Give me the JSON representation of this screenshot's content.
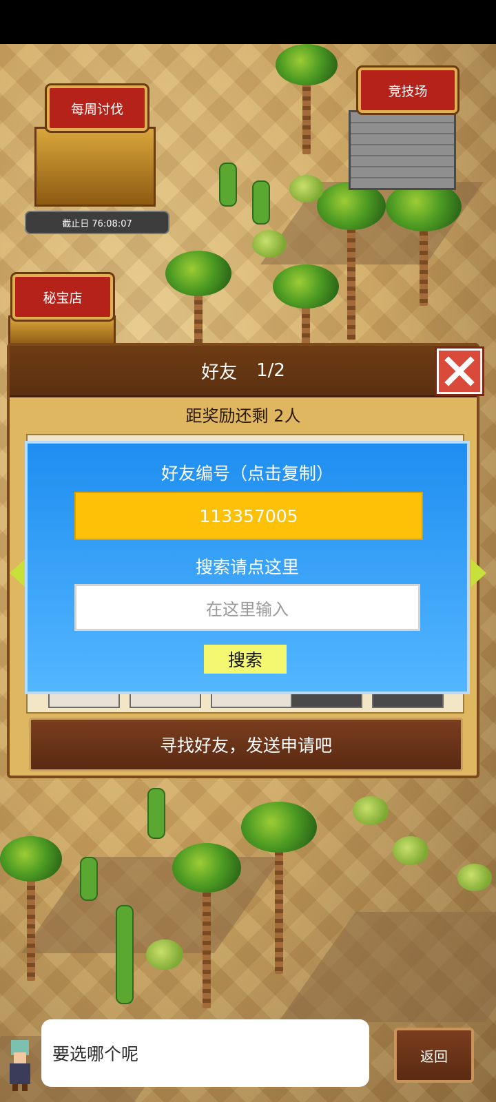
{
  "map": {
    "weekly_subjugation_label": "每周讨伐",
    "deadline_text": "截止日 76:08:07",
    "arena_label": "竞技场",
    "treasure_shop_label": "秘宝店"
  },
  "friend_panel": {
    "title": "好友",
    "page": "1/2",
    "reward_text": "距奖励还剩 2人",
    "find_friends_button": "寻找好友，发送申请吧"
  },
  "friend_dialog": {
    "title": "好友编号（点击复制）",
    "friend_id": "113357005",
    "search_hint": "搜索请点这里",
    "input_placeholder": "在这里输入",
    "search_button": "搜索"
  },
  "bottom": {
    "speech_text": "要选哪个呢",
    "back_button": "返回"
  },
  "colors": {
    "accent_gold": "#ffc107",
    "dialog_blue": "#1f8ef0",
    "close_red": "#d94a3a",
    "button_brown": "#7a3d1e"
  },
  "icons": [
    "close-icon",
    "left-arrow-icon",
    "right-arrow-icon",
    "character-avatar-icon"
  ]
}
